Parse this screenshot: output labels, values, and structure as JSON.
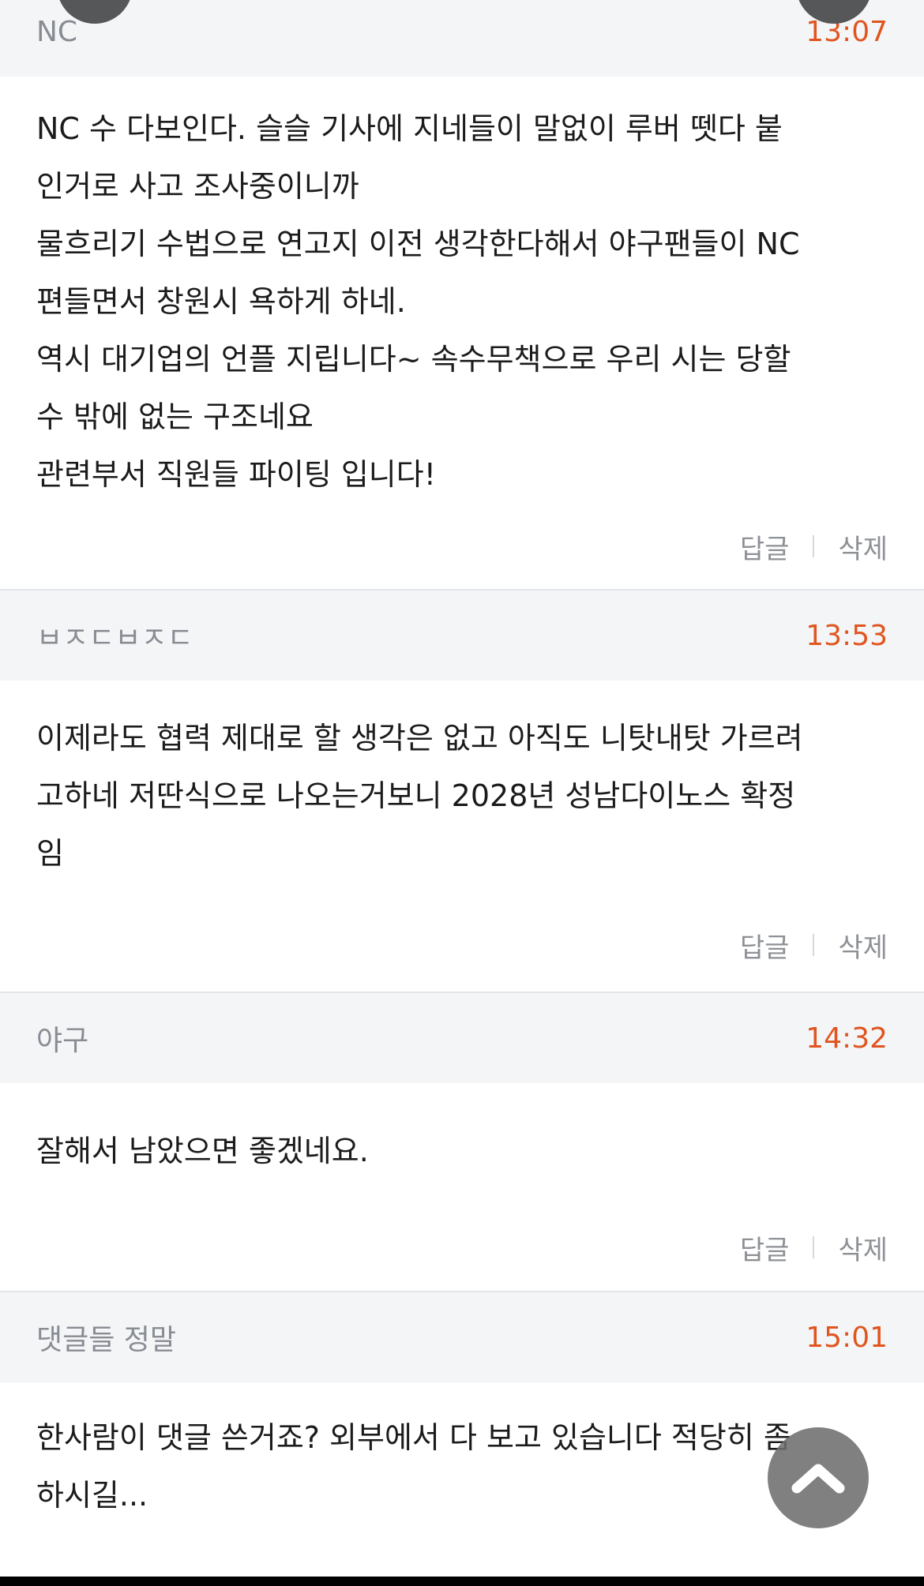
{
  "comments": [
    {
      "author": "NC",
      "time": "13:07",
      "body": "NC 수 다보인다. 슬슬 기사에 지네들이 말없이 루버 뗏다 붙\n인거로 사고 조사중이니까\n물흐리기 수법으로 연고지 이전 생각한다해서 야구팬들이 NC\n편들면서 창원시 욕하게 하네.\n역시 대기업의 언플 지립니다~ 속수무책으로 우리 시는 당할\n수 밖에 없는 구조네요\n관련부서 직원들 파이팅 입니다!",
      "reply_label": "답글",
      "delete_label": "삭제"
    },
    {
      "author": "ㅂㅈㄷㅂㅈㄷ",
      "time": "13:53",
      "body": "이제라도 협력 제대로 할 생각은 없고 아직도 니탓내탓 가르려\n고하네 저딴식으로 나오는거보니 2028년 성남다이노스 확정\n임",
      "reply_label": "답글",
      "delete_label": "삭제"
    },
    {
      "author": "야구",
      "time": "14:32",
      "body": "잘해서 남았으면 좋겠네요.",
      "reply_label": "답글",
      "delete_label": "삭제"
    },
    {
      "author": "댓글들 정말",
      "time": "15:01",
      "body": "한사람이 댓글 쓴거죠? 외부에서 다 보고 있습니다 적당히 좀\n하시길..."
    }
  ],
  "scroll_top_icon": "chevron-up-icon",
  "colors": {
    "header_bg": "#f4f5f7",
    "time": "#e0551f",
    "author": "#888c93",
    "action": "#8d9095"
  }
}
